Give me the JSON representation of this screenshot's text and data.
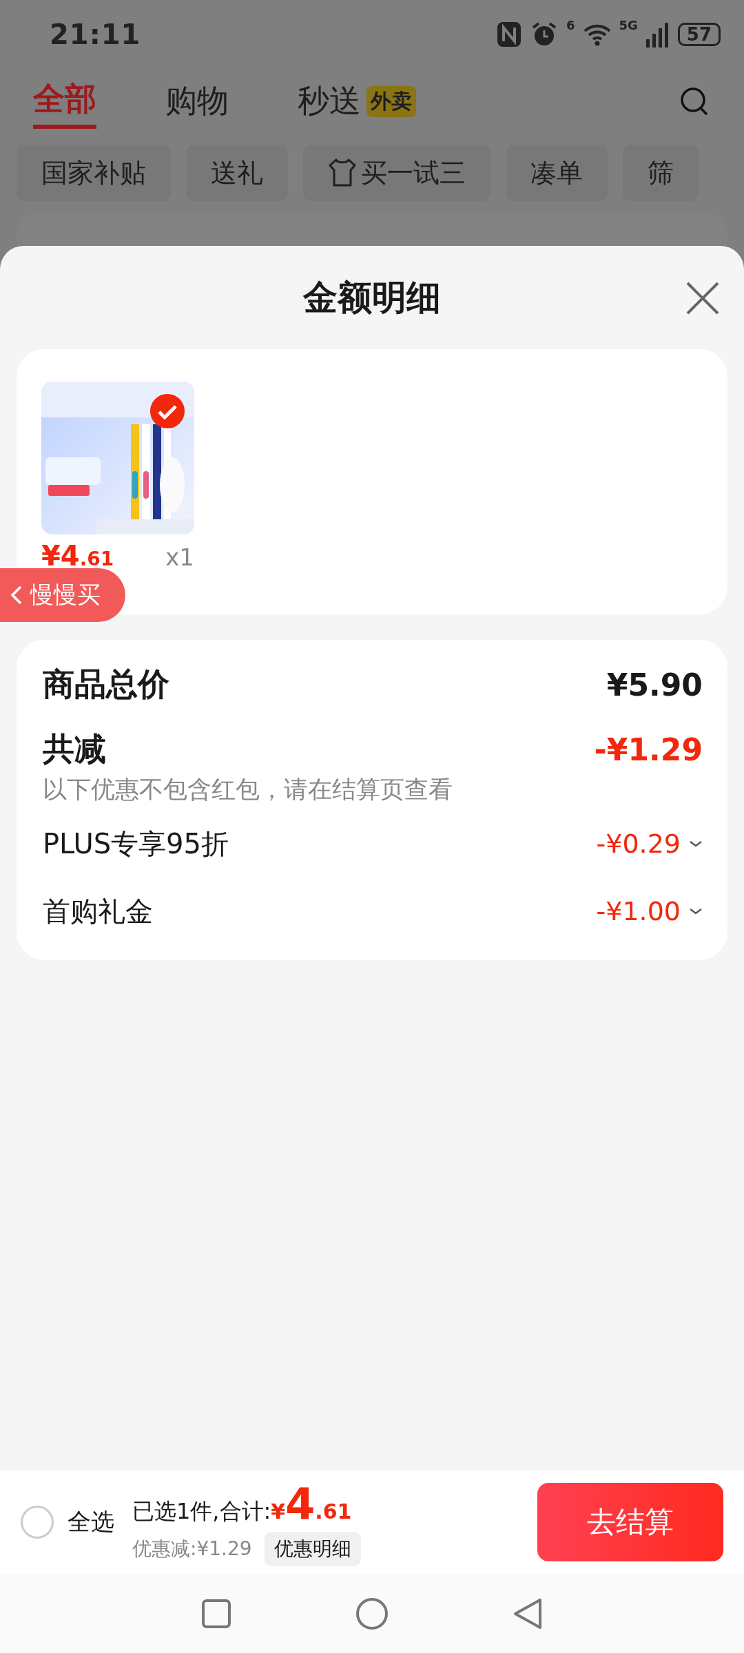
{
  "status_bar": {
    "time": "21:11",
    "wifi_label": "6",
    "network": "5G",
    "battery": "57"
  },
  "tabs": [
    {
      "label": "全部",
      "selected": true
    },
    {
      "label": "购物",
      "selected": false
    },
    {
      "label": "秒送",
      "selected": false,
      "badge": "外卖"
    }
  ],
  "chips": [
    {
      "label": "国家补贴",
      "kind": "plain"
    },
    {
      "label": "送礼",
      "kind": "plain"
    },
    {
      "label": "买一试三",
      "kind": "icon"
    },
    {
      "label": "凑单",
      "kind": "plain"
    },
    {
      "label": "筛",
      "kind": "plain"
    }
  ],
  "sheet": {
    "title": "金额明细",
    "item": {
      "kind": "picture",
      "selected": true,
      "price_main": "¥4",
      "price_decimal": ".61",
      "quantity": "x1"
    },
    "float_button": "慢慢买",
    "total": {
      "label": "商品总价",
      "value": "¥5.90"
    },
    "reduction": {
      "label": "共减",
      "value": "-¥1.29",
      "note": "以下优惠不包含红包，请在结算页查看"
    },
    "discounts": [
      {
        "label": "PLUS专享95折",
        "value": "-¥0.29"
      },
      {
        "label": "首购礼金",
        "value": "-¥1.00"
      }
    ]
  },
  "bottom_bar": {
    "select_all": {
      "label": "全选",
      "checked": false
    },
    "summary": "已选1件,合计:",
    "currency": "¥",
    "integer": "4",
    "decimal": ".61",
    "saving": "优惠减:¥1.29",
    "detail_button": "优惠明细",
    "checkout": "去结算"
  }
}
